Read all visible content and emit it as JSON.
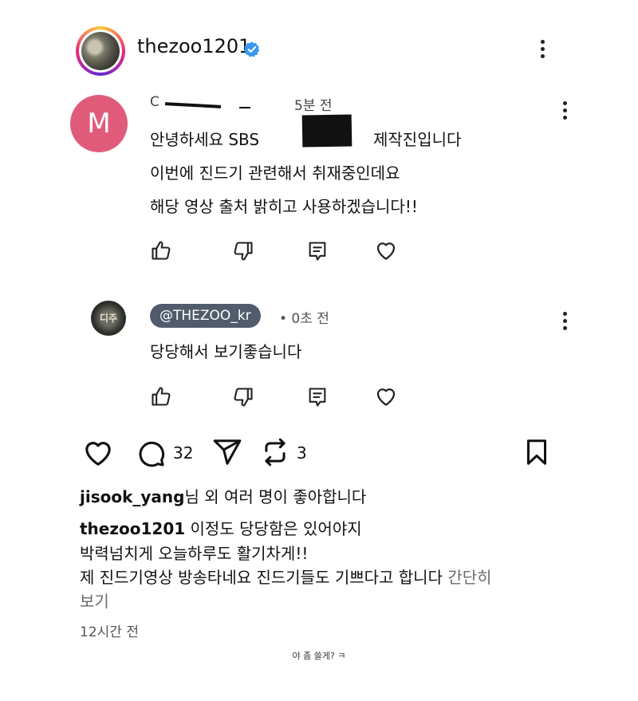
{
  "header": {
    "username": "thezoo1201"
  },
  "comment": {
    "avatar_letter": "M",
    "meta_prefix": "C",
    "time": "5분 전",
    "line1_a": "안녕하세요 SBS",
    "line1_b": "제작진입니다",
    "line2": "이번에 진드기 관련해서 취재중인데요",
    "line3": "해당 영상 출처 밝히고 사용하겠습니다!!"
  },
  "reply": {
    "avatar_text": "디주",
    "handle": "@THEZOO_kr",
    "time": "• 0초 전",
    "text": "당당해서 보기좋습니다"
  },
  "post": {
    "comment_count": "32",
    "repost_count": "3",
    "likes_user": "jisook_yang",
    "likes_suffix": "님 외 여러 명이 좋아합니다",
    "caption_user": "thezoo1201",
    "caption_line1": "이정도 당당함은 있어야지",
    "caption_line2": "박력넘치게 오늘하루도 활기차게!!",
    "caption_line3": "제 진드기영상 방송타네요 진드기들도 기쁘다고 합니다",
    "more_label_1": "간단히",
    "more_label_2": "보기",
    "time_ago": "12시간 전"
  },
  "footnote": "야 좀 쓸게? ㅋ",
  "colors": {
    "m_avatar": "#e05b7a",
    "handle_pill": "#505c6b",
    "verified": "#3897f0"
  },
  "icons": [
    "verified-badge-icon",
    "more-options-icon",
    "thumbs-up-icon",
    "thumbs-down-icon",
    "reply-icon",
    "heart-icon",
    "comment-icon",
    "share-icon",
    "repost-icon",
    "bookmark-icon"
  ]
}
